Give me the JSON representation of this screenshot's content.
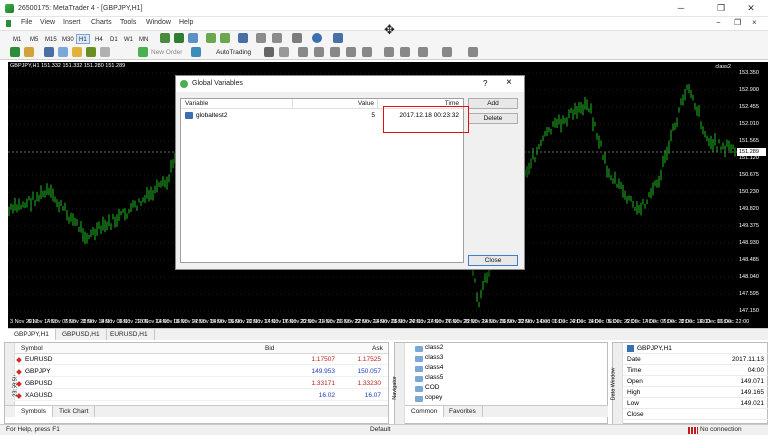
{
  "window": {
    "title": "26500175: MetaTrader 4 - [GBPJPY,H1]",
    "minimize": "─",
    "restore": "❐",
    "close": "✕"
  },
  "menu": [
    "File",
    "View",
    "Insert",
    "Charts",
    "Tools",
    "Window",
    "Help"
  ],
  "mdi": {
    "minimize": "−",
    "restore": "❐",
    "close": "×"
  },
  "toolbar1": {
    "timeframes": [
      "M1",
      "M5",
      "M15",
      "M30",
      "H1",
      "H4",
      "D1",
      "W1",
      "MN"
    ]
  },
  "toolbar2": {
    "new_order": "New Order",
    "autotrading": "AutoTrading"
  },
  "chart": {
    "info": "GBPJPY,H1  151.332 151.332 151.280 151.289",
    "label": "class2",
    "current_price": "151.289",
    "price_labels": [
      "153.350",
      "152.900",
      "152.455",
      "152.010",
      "151.565",
      "151.120",
      "150.675",
      "150.230",
      "149.820",
      "149.375",
      "148.930",
      "148.485",
      "148.040",
      "147.595",
      "147.150"
    ],
    "time_labels": [
      "3 Nov 2017",
      "6 Nov 14:00",
      "7 Nov 06:00",
      "7 Nov 22:00",
      "8 Nov 14:00",
      "9 Nov 06:00",
      "9 Nov 22:00",
      "10 Nov 14:00",
      "13 Nov 06:00",
      "13 Nov 22:00",
      "14 Nov 14:00",
      "15 Nov 06:00",
      "15 Nov 22:00",
      "16 Nov 14:00",
      "17 Nov 06:00",
      "17 Nov 22:00",
      "20 Nov 14:00",
      "21 Nov 06:00",
      "21 Nov 22:00",
      "22 Nov 14:00",
      "23 Nov 06:00",
      "23 Nov 22:00",
      "24 Nov 14:00",
      "27 Nov 06:00",
      "27 Nov 22:00",
      "28 Nov 14:00",
      "29 Nov 06:00",
      "29 Nov 22:00",
      "30 Nov 14:00",
      "1 Dec 06:00",
      "1 Dec 22:00",
      "4 Dec 14:00",
      "5 Dec 06:00",
      "5 Dec 22:00",
      "6 Dec 14:00",
      "7 Dec 06:00",
      "7 Dec 22:00",
      "8 Dec 14:00",
      "11 Dec 06:00",
      "11 Dec 22:00"
    ],
    "tabs": [
      "GBPJPY,H1",
      "GBPUSD,H1",
      "EURUSD,H1"
    ]
  },
  "dialog": {
    "title": "Global Variables",
    "help": "?",
    "close": "×",
    "columns": [
      "Variable",
      "Value",
      "Time"
    ],
    "rows": [
      {
        "name": "globaltest2",
        "value": "5",
        "time": "2017.12.18 00:23:32"
      }
    ],
    "buttons": {
      "add": "Add",
      "delete": "Delete",
      "close": "Close"
    }
  },
  "market_watch": {
    "vertical_label": "23:59:59",
    "columns": [
      "Symbol",
      "Bid",
      "Ask"
    ],
    "rows": [
      {
        "symbol": "EURUSD",
        "bid": "1.17507",
        "ask": "1.17525"
      },
      {
        "symbol": "GBPJPY",
        "bid": "149.953",
        "ask": "150.057"
      },
      {
        "symbol": "GBPUSD",
        "bid": "1.33171",
        "ask": "1.33230"
      },
      {
        "symbol": "XAGUSD",
        "bid": "16.02",
        "ask": "16.07"
      }
    ],
    "tabs": [
      "Symbols",
      "Tick Chart"
    ]
  },
  "navigator": {
    "vertical_label": "Navigator",
    "items": [
      "class2",
      "class3",
      "class4",
      "class5",
      "COD",
      "copey"
    ],
    "tabs": [
      "Common",
      "Favorites"
    ]
  },
  "data_window": {
    "vertical_label": "Data Window",
    "header": "GBPJPY,H1",
    "rows": [
      {
        "k": "Date",
        "v": "2017.11.13"
      },
      {
        "k": "Time",
        "v": "04:00"
      },
      {
        "k": "Open",
        "v": "149.071"
      },
      {
        "k": "High",
        "v": "149.165"
      },
      {
        "k": "Low",
        "v": "149.021"
      },
      {
        "k": "Close",
        "v": ""
      }
    ]
  },
  "status": {
    "help": "For Help, press F1",
    "profile": "Default",
    "connection": "No connection"
  },
  "colors": {
    "candle": "#1a9a1a",
    "background": "#000000",
    "highlight": "#e01010"
  }
}
